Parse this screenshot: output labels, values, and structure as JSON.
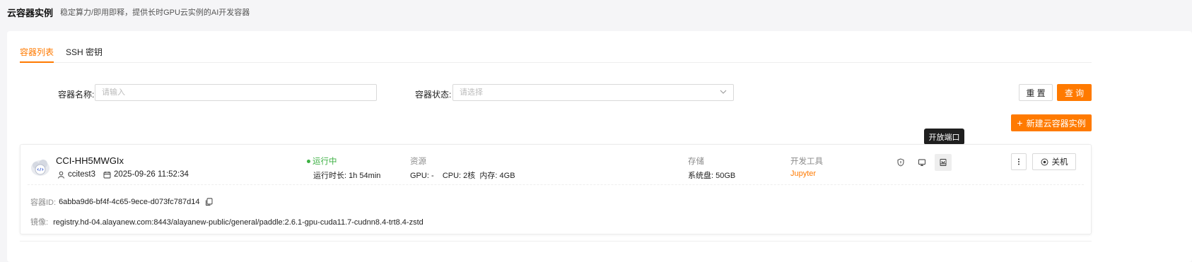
{
  "header": {
    "title": "云容器实例",
    "description": "稳定算力/即用即释，提供长时GPU云实例的AI开发容器"
  },
  "tabs": [
    {
      "label": "容器列表",
      "active": true
    },
    {
      "label": "SSH 密钥",
      "active": false
    }
  ],
  "filters": {
    "name_label": "容器名称:",
    "name_placeholder": "请输入",
    "status_label": "容器状态:",
    "status_placeholder": "请选择"
  },
  "buttons": {
    "reset": "重 置",
    "query": "查 询",
    "new_instance": "新建云容器实例"
  },
  "tooltip": "开放端口",
  "instance": {
    "name": "CCI-HH5MWGIx",
    "user": "ccitest3",
    "created_at": "2025-09-26 11:52:34",
    "status": "运行中",
    "runtime_label": "运行时长:",
    "runtime_value": "1h 54min",
    "resources_label": "资源",
    "resources_value": "GPU: -    CPU: 2核  内存: 4GB",
    "storage_label": "存储",
    "storage_value": "系统盘: 50GB",
    "devtools_label": "开发工具",
    "devtools_value": "Jupyter",
    "power_off": "关机",
    "container_id_label": "容器ID:",
    "container_id": "6abba9d6-bf4f-4c65-9ece-d073fc787d14",
    "image_label": "镜像:",
    "image": "registry.hd-04.alayanew.com:8443/alayanew-public/general/paddle:2.6.1-gpu-cuda11.7-cudnn8.4-trt8.4-zstd"
  },
  "colors": {
    "accent": "#ff7a00",
    "running": "#3cb043"
  }
}
